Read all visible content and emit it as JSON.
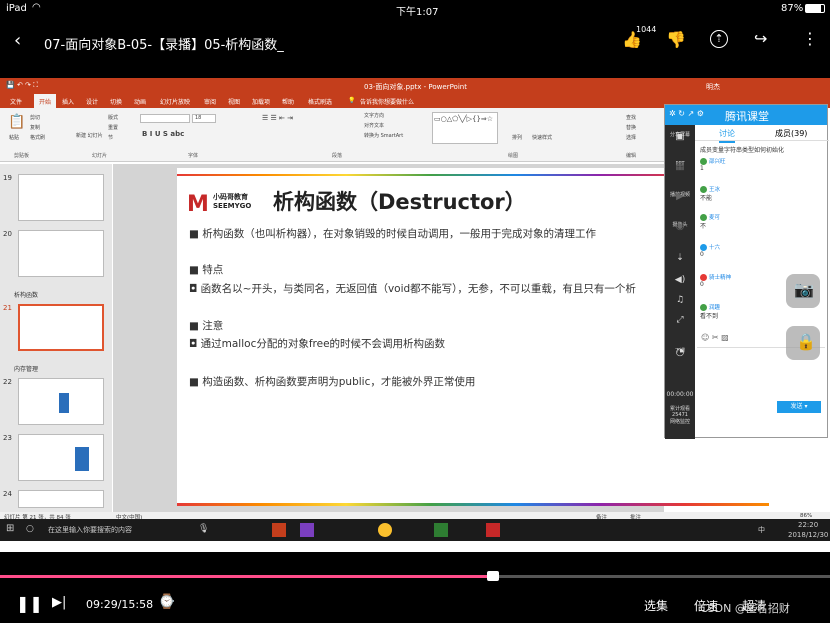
{
  "status_bar": {
    "carrier": "iPad",
    "time": "下午1:07",
    "battery": "87%"
  },
  "nav": {
    "title": "07-面向对象B-05-【录播】05-析构函数_",
    "like_count": "1044"
  },
  "ppt": {
    "window_title": "03-面向对象.pptx - PowerPoint",
    "user": "明杰",
    "menu": [
      "文件",
      "开始",
      "插入",
      "设计",
      "切换",
      "动画",
      "幻灯片放映",
      "审阅",
      "视图",
      "加载项",
      "帮助",
      "格式刷选"
    ],
    "search_hint": "告诉我你想要做什么",
    "ribbon_groups": [
      "剪贴板",
      "幻灯片",
      "字体",
      "段落",
      "绘图",
      "编辑"
    ],
    "ribbon_labels": {
      "paste": "粘贴",
      "cut": "剪切",
      "copy": "复制",
      "format": "格式刷",
      "new_slide": "新建\n幻灯片",
      "layout": "版式",
      "reset": "重置",
      "section": "节",
      "text_dir": "文字方向",
      "align_text": "对齐文本",
      "smartart": "转换为 SmartArt",
      "arrange": "排列",
      "quick_style": "快速样式",
      "find": "查找",
      "replace": "替换",
      "select": "选择",
      "font_size": "18"
    },
    "section_labels": [
      "析构函数",
      "内存管理"
    ],
    "thumb_numbers": [
      "19",
      "20",
      "21",
      "22",
      "23",
      "24"
    ],
    "status_left": "幻灯片 第 21 张，共 84 张",
    "status_lang": "中文(中国)",
    "notes": "备注",
    "comments": "批注",
    "zoom": "86%"
  },
  "slide": {
    "logo_cn": "小码哥教育",
    "logo_en": "SEEMYGO",
    "title": "析构函数（Destructor）",
    "lines": [
      "■ 析构函数（也叫析构器），在对象销毁的时候自动调用，一般用于完成对象的清理工作",
      "■ 特点",
      "◘ 函数名以~开头，与类同名，无返回值（void都不能写），无参，不可以重载，有且只有一个析",
      "■ 注意",
      "◘ 通过malloc分配的对象free的时候不会调用析构函数",
      "■ 构造函数、析构函数要声明为public，才能被外界正常使用"
    ]
  },
  "tencent": {
    "brand": "腾讯课堂",
    "tab_discuss": "讨论",
    "tab_members": "成员(39)",
    "side": [
      "分享屏幕",
      "PPT",
      "播放视频",
      "摄像头",
      "",
      "",
      "",
      "下课"
    ],
    "timer": "00:00:00",
    "viewers": "累计观看\n25471\n网络监控",
    "first_msg": "成员变量字符串类型如何初始化",
    "chats": [
      {
        "name": "邵兴旺",
        "msg": "1"
      },
      {
        "name": "王冰",
        "msg": "不能"
      },
      {
        "name": "麦可",
        "msg": "不"
      },
      {
        "name": "十六",
        "msg": "0"
      },
      {
        "name": "骑士精神",
        "msg": "0"
      },
      {
        "name": "润趣",
        "msg": "看不到"
      }
    ],
    "send": "发送"
  },
  "taskbar": {
    "search": "在这里输入你要搜索的内容",
    "time": "22:20",
    "date": "2018/12/30",
    "ime": "中"
  },
  "player": {
    "time": "09:29/15:58",
    "chapters": "选集",
    "speed": "倍速",
    "quality": "超清",
    "watermark": "CSDN @匿名招财",
    "progress": 0.594
  }
}
